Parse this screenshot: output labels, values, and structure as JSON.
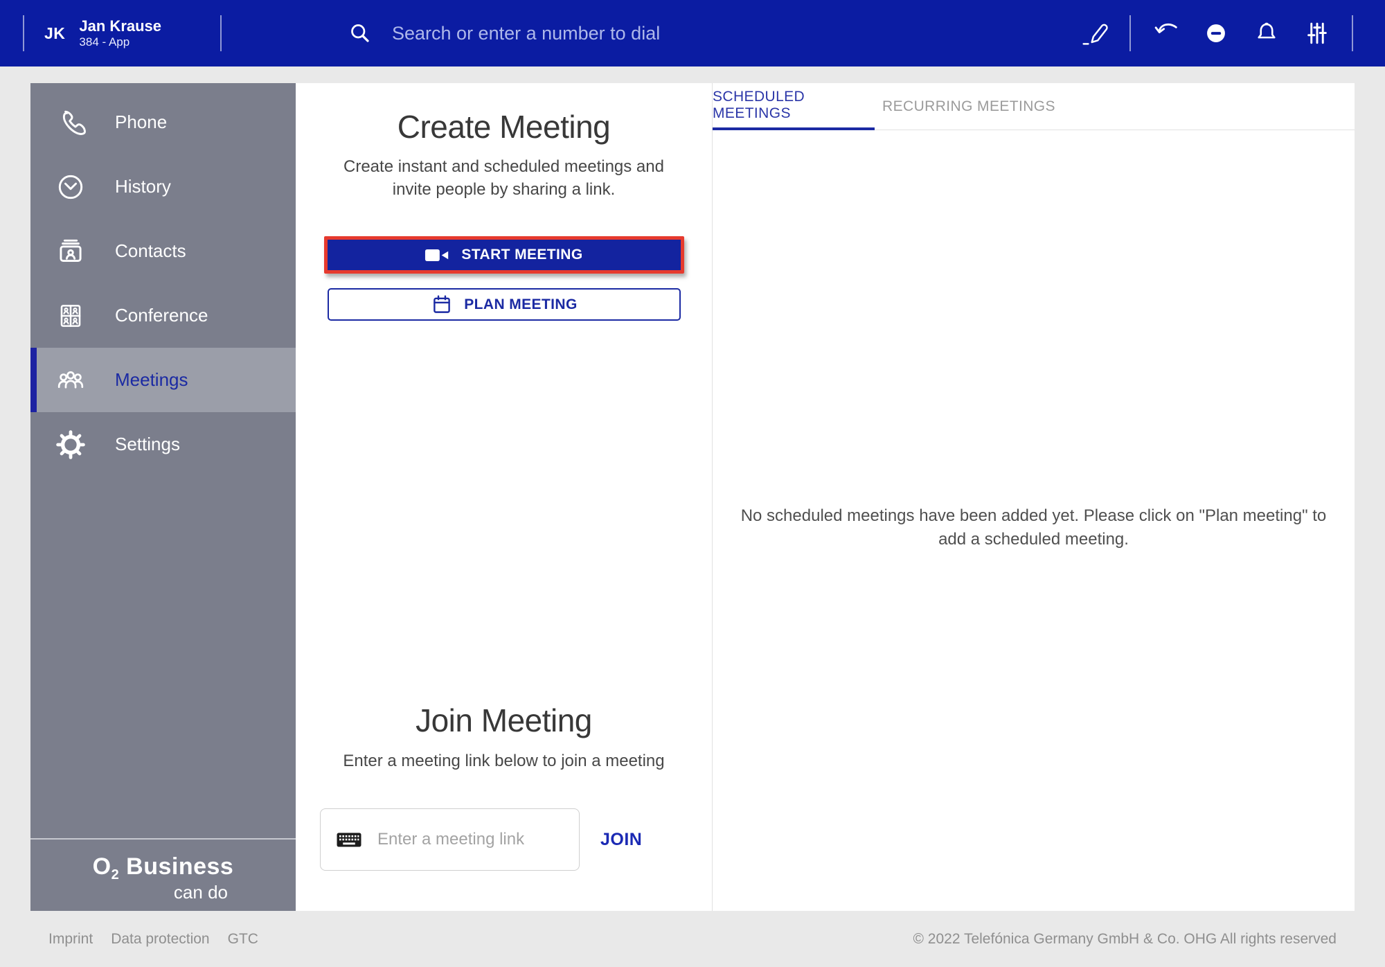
{
  "topbar": {
    "user_initials": "JK",
    "user_name": "Jan Krause",
    "user_line": "384 - App",
    "search_placeholder": "Search or enter a number to dial",
    "icons": [
      "edit-icon",
      "call-pull-icon",
      "dnd-status-icon",
      "notifications-icon",
      "audio-settings-icon"
    ]
  },
  "sidebar": {
    "items": [
      {
        "label": "Phone",
        "icon": "phone-icon",
        "active": false
      },
      {
        "label": "History",
        "icon": "history-icon",
        "active": false
      },
      {
        "label": "Contacts",
        "icon": "contacts-icon",
        "active": false
      },
      {
        "label": "Conference",
        "icon": "conference-icon",
        "active": false
      },
      {
        "label": "Meetings",
        "icon": "meetings-icon",
        "active": true
      },
      {
        "label": "Settings",
        "icon": "settings-icon",
        "active": false
      }
    ],
    "logo": {
      "brand": "O",
      "sub": "2",
      "suffix": " Business",
      "tagline": "can do"
    }
  },
  "create_meeting": {
    "title": "Create Meeting",
    "description": "Create instant and scheduled meetings and invite people by sharing a link.",
    "start_button": "START MEETING",
    "plan_button": "PLAN MEETING"
  },
  "join_meeting": {
    "title": "Join Meeting",
    "description": "Enter a meeting link below to join a meeting",
    "input_placeholder": "Enter a meeting link",
    "join_button": "JOIN"
  },
  "meetings_panel": {
    "tabs": [
      {
        "label": "SCHEDULED MEETINGS",
        "active": true
      },
      {
        "label": "RECURRING MEETINGS",
        "active": false
      }
    ],
    "empty_message": "No scheduled meetings have been added yet. Please click on \"Plan meeting\" to add a scheduled meeting."
  },
  "footer": {
    "links": [
      "Imprint",
      "Data protection",
      "GTC"
    ],
    "copyright": "© 2022 Telefónica Germany GmbH & Co. OHG All rights reserved"
  },
  "colors": {
    "topbar_blue": "#0b1ca2",
    "button_blue": "#13239f",
    "accent_blue": "#1b2aa3",
    "sidebar_gray": "#7b7e8c",
    "sidebar_active_gray": "#9b9ea9",
    "highlight_red": "#e63a2e",
    "page_gray": "#e9e9e9"
  }
}
